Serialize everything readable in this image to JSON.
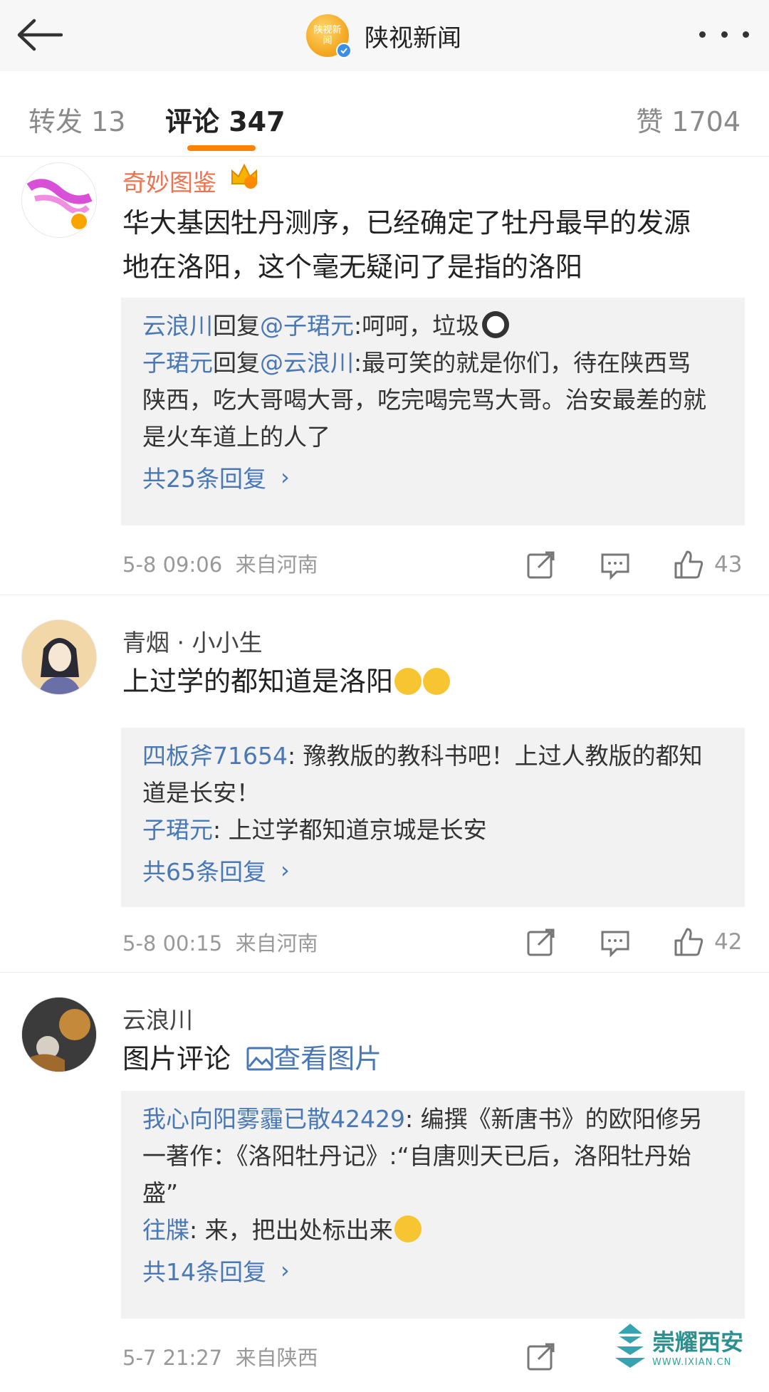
{
  "header": {
    "title": "陕视新闻",
    "avatar_text": "陕视新闻"
  },
  "tabs": {
    "forward": "转发 13",
    "comments": "评论 347",
    "likes": "赞 1704"
  },
  "comments": [
    {
      "username": "奇妙图鉴",
      "text_line1": "华大基因牡丹测序，已经确定了牡丹最早的发源",
      "text_line2": "地在洛阳，这个毫无疑问了是指的洛阳",
      "replies": [
        {
          "name": "云浪川",
          "mid": "回复",
          "target": "@子珺元",
          "text": ":呵呵，垃圾"
        },
        {
          "name": "子珺元",
          "mid": "回复",
          "target": "@云浪川",
          "text": ":最可笑的就是你们，待在陕西骂",
          "line2": "陕西，吃大哥喝大哥，吃完喝完骂大哥。治安最差的就",
          "line3": "是火车道上的人了"
        }
      ],
      "more": "共25条回复",
      "time": "5-8 09:06",
      "location": "来自河南",
      "likes": "43"
    },
    {
      "username": "青烟 · 小小生",
      "text": "上过学的都知道是洛阳",
      "replies": [
        {
          "name": "四板斧71654",
          "text": ": 豫教版的教科书吧！上过人教版的都知",
          "line2": "道是长安！"
        },
        {
          "name": "子珺元",
          "text": ": 上过学都知道京城是长安"
        }
      ],
      "more": "共65条回复",
      "time": "5-8 00:15",
      "location": "来自河南",
      "likes": "42"
    },
    {
      "username": "云浪川",
      "text": "图片评论",
      "image_link": "查看图片",
      "replies": [
        {
          "name": "我心向阳雾霾已散42429",
          "text": ": 编撰《新唐书》的欧阳修另",
          "line2": "一著作：《洛阳牡丹记》:“自唐则天已后，洛阳牡丹始",
          "line3": "盛”"
        },
        {
          "name": "往牒",
          "text": ": 来，把出处标出来"
        }
      ],
      "more": "共14条回复",
      "time": "5-7 21:27",
      "location": "来自陕西"
    }
  ],
  "watermark": {
    "main": "崇耀西安",
    "sub": "WWW.IXIAN.CN"
  }
}
